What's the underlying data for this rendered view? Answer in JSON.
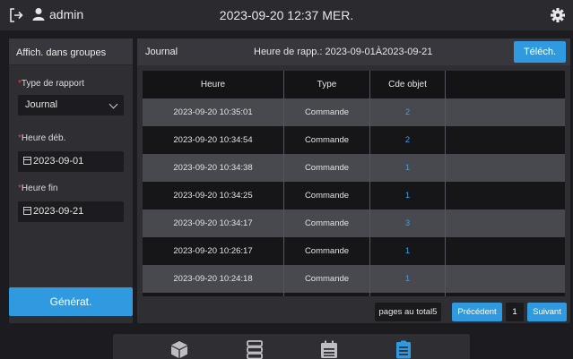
{
  "topbar": {
    "username": "admin",
    "datetime": "2023-09-20 12:37 MER."
  },
  "sidebar": {
    "title": "Affich. dans groupes",
    "report_type_label": "Type de rapport",
    "report_type_value": "Journal",
    "start_label": "Heure déb.",
    "start_value": "2023-09-01",
    "end_label": "Heure fin",
    "end_value": "2023-09-21",
    "generate_label": "Générat."
  },
  "report": {
    "title": "Journal",
    "period": "Heure de rapp.: 2023-09-01À2023-09-21",
    "download_label": "Téléch.",
    "columns": [
      "Heure",
      "Type",
      "Cde objet",
      ""
    ],
    "rows": [
      {
        "time": "2023-09-20 10:35:01",
        "type": "Commande",
        "obj": "2"
      },
      {
        "time": "2023-09-20 10:34:54",
        "type": "Commande",
        "obj": "2"
      },
      {
        "time": "2023-09-20 10:34:38",
        "type": "Commande",
        "obj": "1"
      },
      {
        "time": "2023-09-20 10:34:25",
        "type": "Commande",
        "obj": "1"
      },
      {
        "time": "2023-09-20 10:34:17",
        "type": "Commande",
        "obj": "3"
      },
      {
        "time": "2023-09-20 10:26:17",
        "type": "Commande",
        "obj": "1"
      },
      {
        "time": "2023-09-20 10:24:18",
        "type": "Commande",
        "obj": "1"
      },
      {
        "time": "",
        "type": "",
        "obj": ""
      }
    ]
  },
  "pagination": {
    "total_label": "pages au total5",
    "prev_label": "Précédent",
    "page": "1",
    "next_label": "Suivant"
  },
  "bottomnav": {
    "items": [
      "cube-icon",
      "server-icon",
      "calendar-icon",
      "report-icon"
    ],
    "active": "report-icon"
  },
  "colors": {
    "accent": "#2f9ae0",
    "required": "#e0444c",
    "link": "#3a9ee8"
  }
}
